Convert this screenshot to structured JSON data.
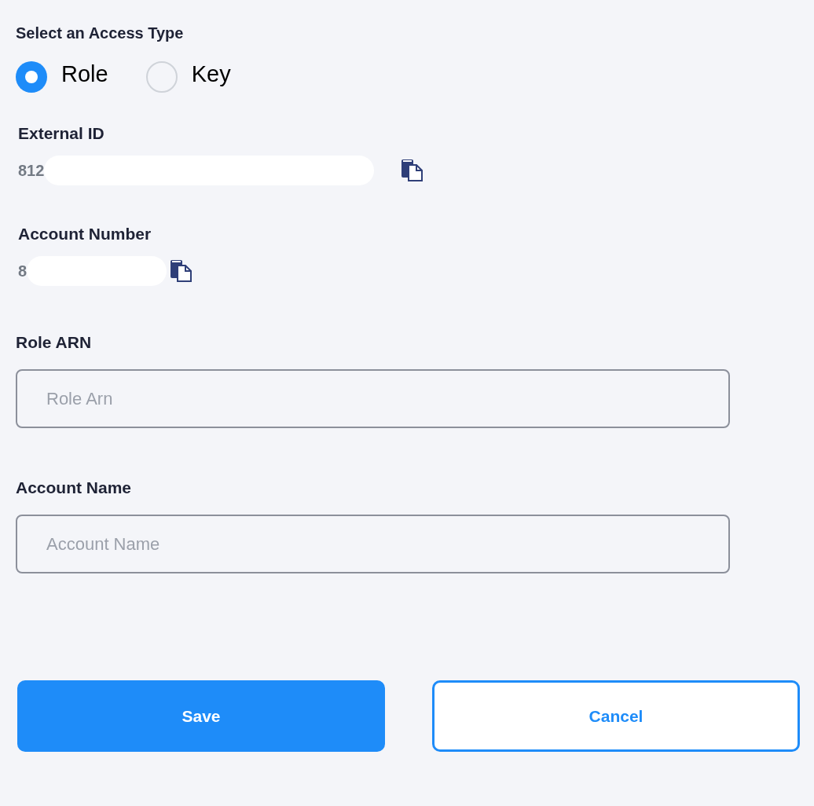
{
  "access_type": {
    "title": "Select an Access Type",
    "options": [
      {
        "label": "Role",
        "selected": true
      },
      {
        "label": "Key",
        "selected": false
      }
    ]
  },
  "copy_fields": [
    {
      "label": "External ID",
      "value": "812"
    },
    {
      "label": "Account Number",
      "value": "8"
    }
  ],
  "inputs": [
    {
      "label": "Role ARN",
      "placeholder": "Role Arn"
    },
    {
      "label": "Account Name",
      "placeholder": "Account Name"
    }
  ],
  "buttons": [
    {
      "label": "Save",
      "kind": "primary"
    },
    {
      "label": "Cancel",
      "kind": "secondary"
    }
  ]
}
